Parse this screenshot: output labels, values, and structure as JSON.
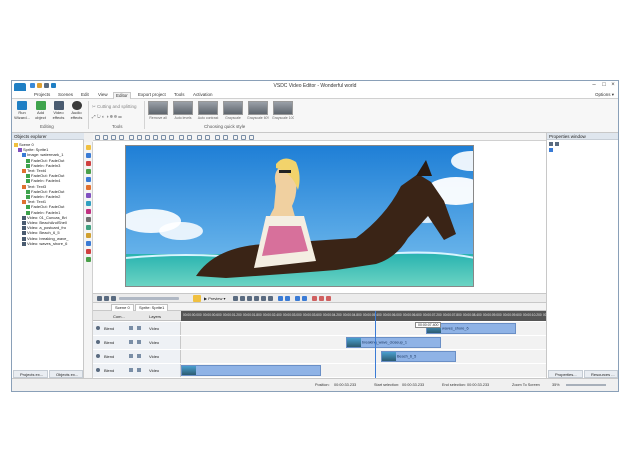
{
  "window": {
    "title": "VSDC Video Editor - Wonderful world"
  },
  "menu": {
    "items": [
      "Projects",
      "Scenes",
      "Edit",
      "View",
      "Editor",
      "Export project",
      "Tools",
      "Activation"
    ],
    "active": "Editor",
    "options_label": "Options"
  },
  "ribbon": {
    "run_wizard": "Run Wizard...",
    "add_object": "Add object",
    "video_effects": "Video effects",
    "audio_effects": "Audio effects",
    "editing_group": "Editing",
    "cutting_label": "Cutting and splitting",
    "tools_group": "Tools",
    "styles_group": "Choosing quick style",
    "styles": [
      "Remove all",
      "Auto levels",
      "Auto contrast",
      "Grayscale",
      "Grayscale 60%",
      "Grayscale 100%"
    ]
  },
  "explorer": {
    "title": "Objects explorer",
    "tree": [
      "Scene 0",
      "Sprite: Sprite1",
      "Image: watermark_1",
      "FadeOut: FadeOut",
      "FadeIn: FadeIn3",
      "Text: Text4",
      "FadeOut: FadeOut",
      "FadeIn: FadeIn4",
      "Text: Text3",
      "FadeOut: FadeOut",
      "FadeIn: FadeIn2",
      "Text: Text1",
      "FadeOut: FadeOut",
      "FadeIn: FadeIn1",
      "Video: 01_Cuncas_Bri",
      "Video: BeachAndShell",
      "Video: a_postcard_fro",
      "Video: Beach_6_5",
      "Video: breaking_wave_",
      "Video: waves_shore_6"
    ],
    "tab_projects": "Projects ex...",
    "tab_objects": "Objects ex..."
  },
  "preview": {
    "label": "Preview"
  },
  "scene_tabs": [
    "Scene 0",
    "Sprite: Sprite1"
  ],
  "timeline": {
    "com_label": "Com...",
    "layers_label": "Layers",
    "ticks": [
      "00:00:00.000",
      "00:00:00.600",
      "00:00:01.200",
      "00:00:01.800",
      "00:00:02.400",
      "00:00:03.000",
      "00:00:03.600",
      "00:00:04.200",
      "00:00:04.800",
      "00:00:05.400",
      "00:00:06.000",
      "00:00:06.600",
      "00:00:07.200",
      "00:00:07.800",
      "00:00:08.400",
      "00:00:09.000",
      "00:00:09.600",
      "00:00:10.200",
      "00:00:10.800"
    ],
    "current_time": "00:00:07.400",
    "tracks": [
      {
        "blend": "Blend",
        "type": "Video",
        "clip": "waves_shore_6"
      },
      {
        "blend": "Blend",
        "type": "Video",
        "clip": "breaking_wave_closeup_1"
      },
      {
        "blend": "Blend",
        "type": "Video",
        "clip": "Beach_6_5"
      },
      {
        "blend": "Blend",
        "type": "Video",
        "clip": ""
      }
    ]
  },
  "properties": {
    "title": "Properties window",
    "tab_properties": "Properties...",
    "tab_resources": "Resources ..."
  },
  "status": {
    "position_label": "Position:",
    "position_value": "00:00:33.233",
    "start_label": "Start selection:",
    "start_value": "00:00:33.233",
    "end_label": "End selection:",
    "end_value": "00:00:33.233",
    "zoom_label": "Zoom To Screen",
    "zoom_value": "35%"
  },
  "colors": {
    "accent": "#1f7fc4",
    "clip": "#8fb3e6",
    "ruler": "#555555"
  }
}
